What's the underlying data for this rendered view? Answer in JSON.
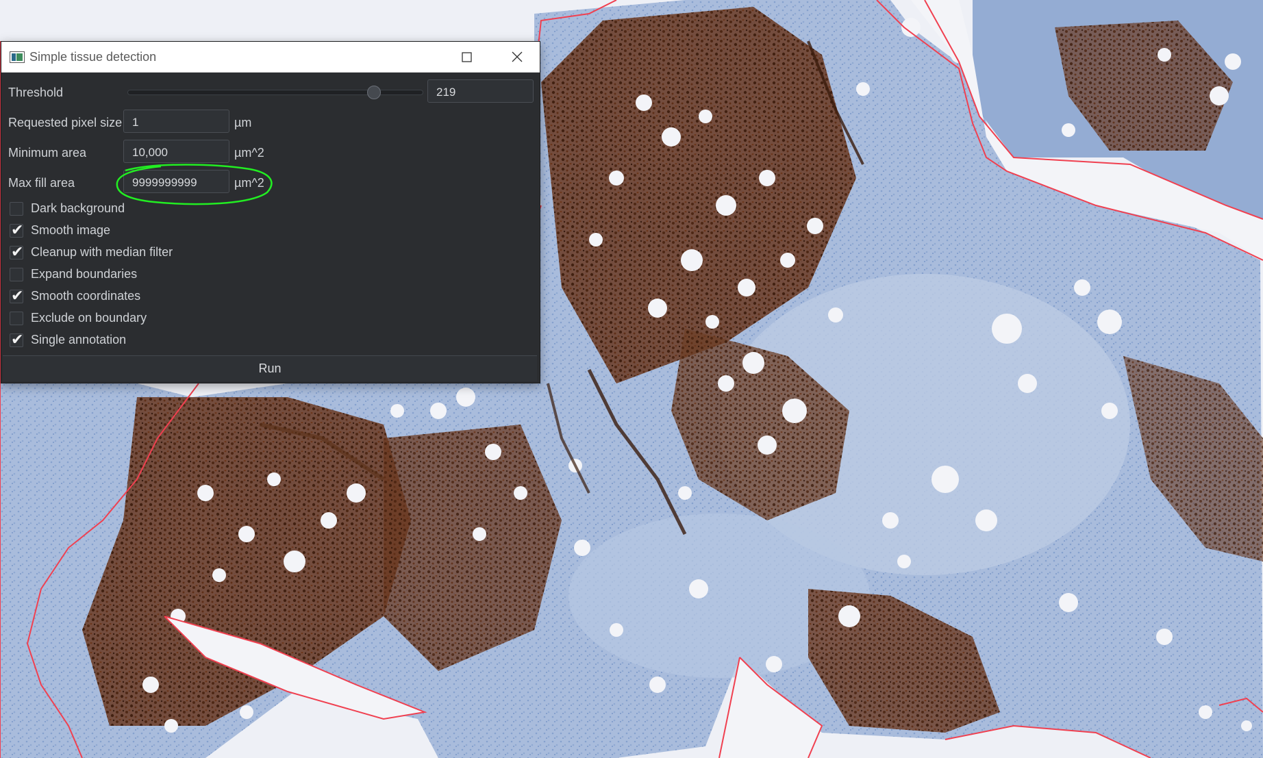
{
  "dialog": {
    "title": "Simple tissue detection",
    "threshold": {
      "label": "Threshold",
      "value": "219",
      "slider_fraction": 0.85
    },
    "pixel_size": {
      "label": "Requested pixel size",
      "value": "1",
      "unit": "µm"
    },
    "min_area": {
      "label": "Minimum area",
      "value": "10,000",
      "unit": "µm^2"
    },
    "max_fill_area": {
      "label": "Max fill area",
      "value": "9999999999",
      "unit": "µm^2"
    },
    "options": [
      {
        "label": "Dark background",
        "checked": false
      },
      {
        "label": "Smooth image",
        "checked": true
      },
      {
        "label": "Cleanup with median filter",
        "checked": true
      },
      {
        "label": "Expand boundaries",
        "checked": false
      },
      {
        "label": "Smooth coordinates",
        "checked": true
      },
      {
        "label": "Exclude on boundary",
        "checked": false
      },
      {
        "label": "Single annotation",
        "checked": true
      }
    ],
    "run_label": "Run"
  },
  "colors": {
    "annotation_outline": "#f04050",
    "highlight": "#22ee22",
    "hematoxylin": "#9fb6d8",
    "dab": "#5a2a12"
  }
}
